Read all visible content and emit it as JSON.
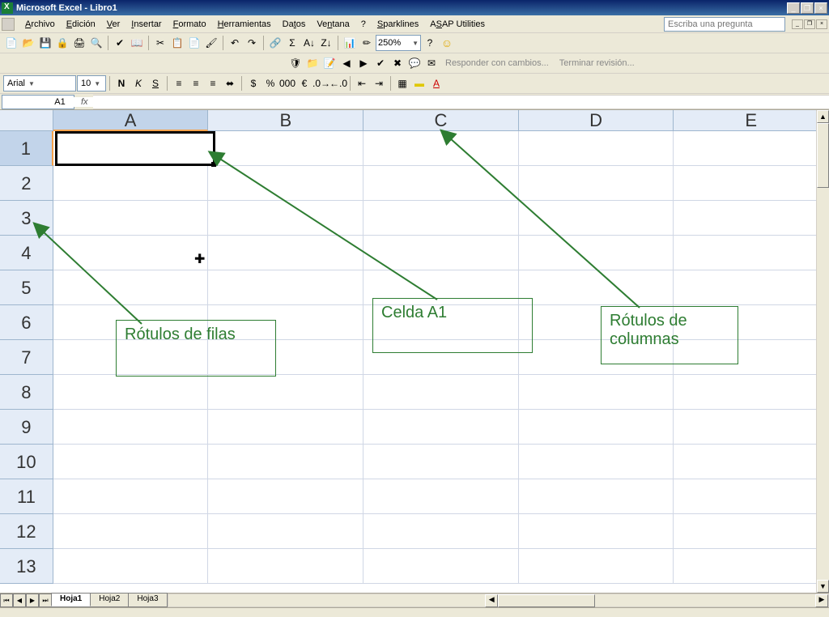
{
  "title": "Microsoft Excel - Libro1",
  "window_buttons": {
    "min": "_",
    "restore": "❐",
    "close": "×"
  },
  "menus": {
    "archivo": "Archivo",
    "edicion": "Edición",
    "ver": "Ver",
    "insertar": "Insertar",
    "formato": "Formato",
    "herramientas": "Herramientas",
    "datos": "Datos",
    "ventana": "Ventana",
    "ayuda": "?",
    "sparklines": "Sparklines",
    "asap": "ASAP Utilities"
  },
  "ask_placeholder": "Escriba una pregunta",
  "doc_buttons": {
    "min": "_",
    "restore": "❐",
    "close": "×"
  },
  "toolbar": {
    "zoom": "250%",
    "review_respond": "Responder con cambios...",
    "review_end": "Terminar revisión..."
  },
  "format": {
    "font": "Arial",
    "size": "10",
    "bold": "N",
    "italic": "K",
    "underline": "S"
  },
  "namebox": "A1",
  "fx_label": "fx",
  "columns": [
    "A",
    "B",
    "C",
    "D",
    "E"
  ],
  "rows": [
    "1",
    "2",
    "3",
    "4",
    "5",
    "6",
    "7",
    "8",
    "9",
    "10",
    "11",
    "12",
    "13"
  ],
  "selected_cell": "A1",
  "sheets": {
    "active": "Hoja1",
    "others": [
      "Hoja2",
      "Hoja3"
    ]
  },
  "tab_nav": {
    "first": "⏮",
    "prev": "◀",
    "next": "▶",
    "last": "⏭"
  },
  "annotations": {
    "rows_label": "Rótulos de filas",
    "cell_label": "Celda A1",
    "cols_label": "Rótulos de columnas"
  }
}
